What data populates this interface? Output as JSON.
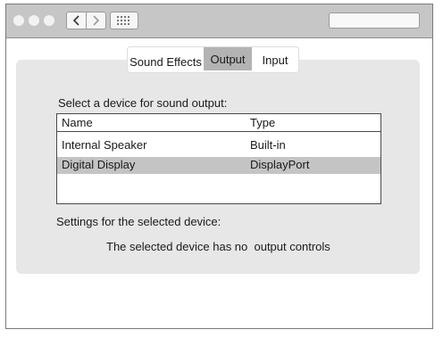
{
  "toolbar": {
    "back_glyph": "<",
    "forward_glyph": ">",
    "grid_icon": "grid-icon",
    "search_placeholder": ""
  },
  "tabs": [
    {
      "label": "Sound Effects",
      "selected": false
    },
    {
      "label": "Output",
      "selected": true
    },
    {
      "label": "Input",
      "selected": false
    }
  ],
  "output": {
    "prompt": "Select a device for sound output:",
    "columns": {
      "name": "Name",
      "type": "Type"
    },
    "devices": [
      {
        "name": "Internal Speaker",
        "type": "Built-in",
        "selected": false
      },
      {
        "name": "Digital Display",
        "type": "DisplayPort",
        "selected": true
      }
    ],
    "settings_label": "Settings for the selected device:",
    "no_controls_message": "The selected device has no  output controls"
  },
  "colors": {
    "titlebar": "#c6c6c6",
    "panel": "#e7e7e7",
    "selected_row": "#c4c4c4",
    "selected_tab": "#b3b3b3"
  }
}
